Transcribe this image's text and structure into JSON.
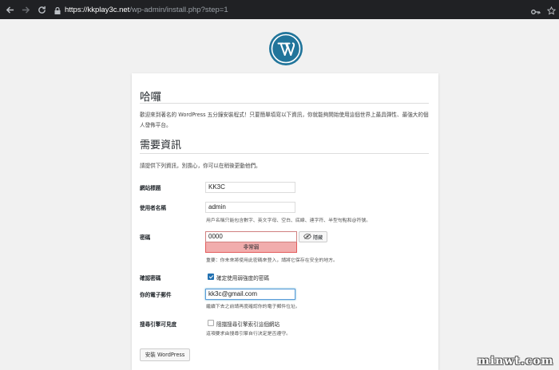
{
  "browser": {
    "url_host": "https://kkplay3c.net",
    "url_path": "/wp-admin/install.php?step=1"
  },
  "page": {
    "heading": "哈囉",
    "intro": "歡迎來到著名的 WordPress 五分鐘安裝程式！只要簡單填寫以下資訊，你就能夠開始使用這個世界上最具彈性、最強大的個人發佈平台。",
    "section_heading": "需要資訊",
    "section_intro": "請提供下列資訊，別擔心，你可以在稍後更動他們。"
  },
  "form": {
    "site_title_label": "網站標題",
    "site_title_value": "KK3C",
    "username_label": "使用者名稱",
    "username_value": "admin",
    "username_desc": "用戶名稱只能包含數字、英文字母、空白、底線、連字符、半型句點和@符號。",
    "password_label": "密碼",
    "password_value": "0000",
    "password_strength": "非常弱",
    "hide_button": "隱藏",
    "password_note": "重要：你未來將使用此密碼來登入，請將它保存在安全的地方。",
    "confirm_label": "確認密碼",
    "confirm_text": "確定使用弱強度的密碼",
    "confirm_checked": true,
    "email_label": "你的電子郵件",
    "email_value": "kk3c@gmail.com",
    "email_desc": "繼續下去之前請再度確認你的電子郵件位址。",
    "search_label": "搜尋引擎可見度",
    "search_text": "阻擋搜尋引擎索引這個網站",
    "search_desc": "這項要求由搜尋引擎自行決定是否遵守。",
    "search_checked": false,
    "install_button": "安裝 WordPress"
  },
  "watermark": "minwt.com",
  "colors": {
    "brand_blue": "#21759b",
    "strength_bg": "#f1adad",
    "checkbox_blue": "#2271b1"
  },
  "icons": [
    "back-arrow-icon",
    "forward-arrow-icon",
    "reload-icon",
    "lock-icon",
    "key-icon",
    "star-icon",
    "wordpress-logo-icon",
    "eye-slash-icon"
  ]
}
